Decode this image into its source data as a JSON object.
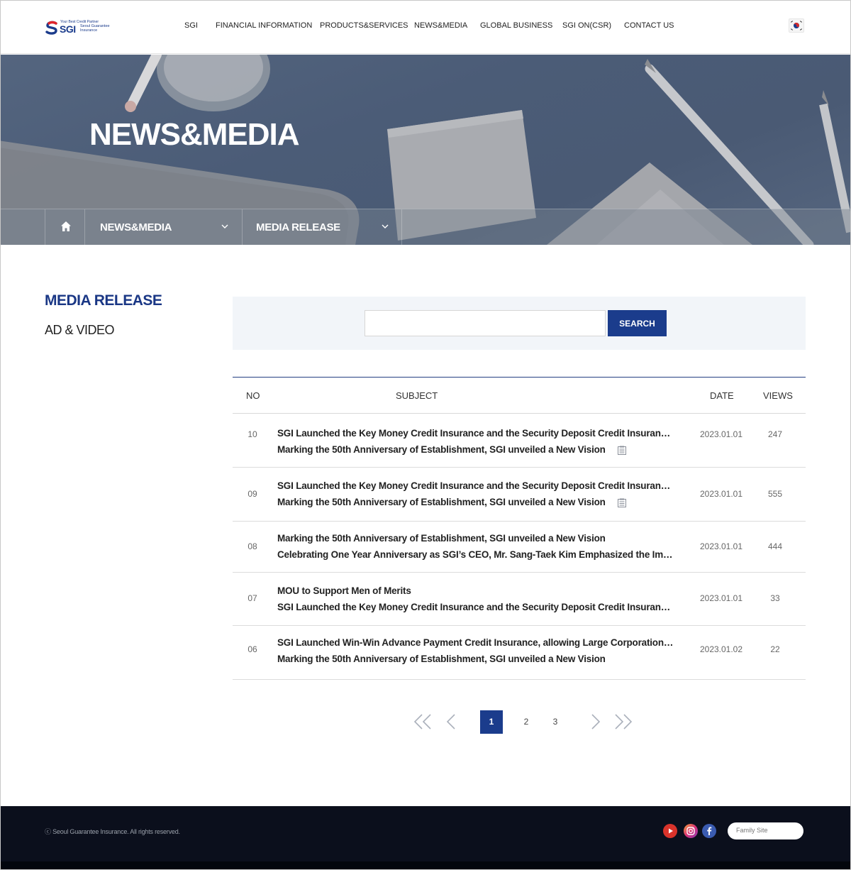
{
  "header": {
    "logo": {
      "tagline": "Your Best Credit Partner",
      "name": "SGI",
      "subname": "Seoul Guarantee Insurance"
    },
    "menu": [
      "SGI",
      "FINANCIAL INFORMATION",
      "PRODUCTS&SERVICES",
      "NEWS&MEDIA",
      "GLOBAL BUSINESS",
      "SGI ON(CSR)",
      "CONTACT US"
    ],
    "language_icon": "korea-flag-icon"
  },
  "visual": {
    "title": "NEWS&MEDIA",
    "location": {
      "home_icon": "home-icon",
      "depth1": "NEWS&MEDIA",
      "depth2": "MEDIA RELEASE"
    }
  },
  "lnb": {
    "title": "MEDIA RELEASE",
    "items": [
      "AD & VIDEO"
    ]
  },
  "search": {
    "placeholder": "",
    "value": "",
    "button": "SEARCH"
  },
  "board": {
    "columns": {
      "no": "NO",
      "subject": "SUBJECT",
      "date": "DATE",
      "views": "VIEWS"
    },
    "rows": [
      {
        "no": "10",
        "lines": [
          "SGI Launched the Key Money Credit Insurance and the Security Deposit Credit Insurance for",
          "Marking the 50th Anniversary of Establishment, SGI unveiled a New Vision"
        ],
        "attachment": true,
        "date": "2023.01.01",
        "views": "247"
      },
      {
        "no": "09",
        "lines": [
          "SGI Launched the Key Money Credit Insurance and the Security Deposit Credit Insurance for",
          "Marking the 50th Anniversary of Establishment, SGI unveiled a New Vision"
        ],
        "attachment": true,
        "date": "2023.01.01",
        "views": "555"
      },
      {
        "no": "08",
        "lines": [
          "Marking the 50th Anniversary of Establishment, SGI unveiled a New Vision",
          "Celebrating One Year Anniversary as SGI’s CEO, Mr. Sang-Taek Kim Emphasized the Importa..."
        ],
        "attachment": false,
        "date": "2023.01.01",
        "views": "444"
      },
      {
        "no": "07",
        "lines": [
          "MOU to Support Men of Merits",
          "SGI Launched the Key Money Credit Insurance and the Security Deposit Credit Insurance for ..."
        ],
        "attachment": false,
        "date": "2023.01.01",
        "views": "33"
      },
      {
        "no": "06",
        "lines": [
          "SGI Launched Win-Win Advance Payment Credit Insurance, allowing Large Corporations to ...",
          "Marking the 50th Anniversary of Establishment, SGI unveiled a New Vision"
        ],
        "attachment": false,
        "date": "2023.01.02",
        "views": "22"
      }
    ]
  },
  "pagination": {
    "pages": [
      "1",
      "2",
      "3"
    ],
    "current": "1"
  },
  "footer": {
    "copyright": "ⓒ Seoul Guarantee Insurance. All rights reserved.",
    "sns": [
      "youtube-icon",
      "instagram-icon",
      "facebook-icon"
    ],
    "family_site": "Family Site"
  },
  "colors": {
    "brand": "#1b3c8c",
    "footer_bg": "#0b0f1c",
    "search_bg": "#f2f5f9"
  }
}
